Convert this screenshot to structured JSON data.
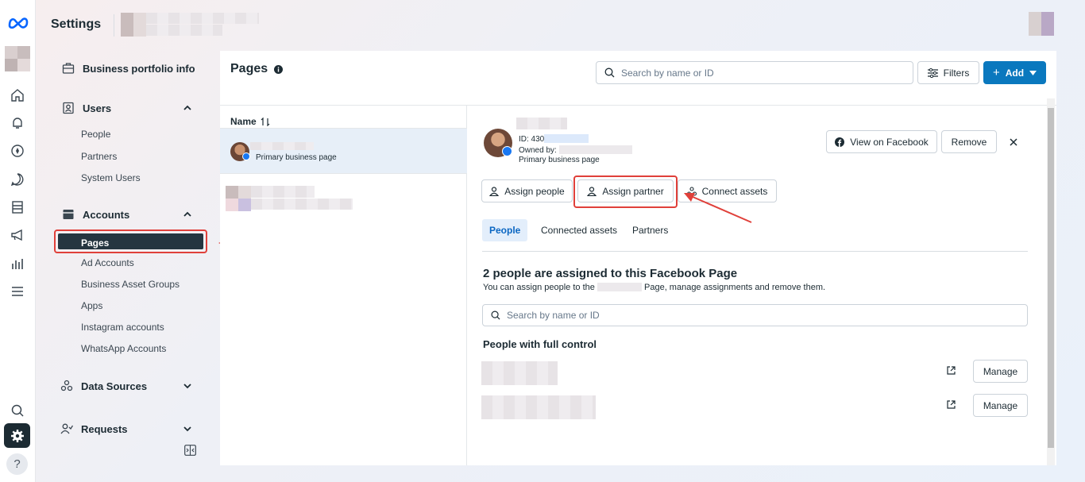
{
  "app": {
    "title": "Settings"
  },
  "rail": {
    "icons": [
      "meta-logo",
      "home-icon",
      "bell-icon",
      "compass-icon",
      "chat-icon",
      "pages-icon",
      "megaphone-icon",
      "chart-icon",
      "menu-icon",
      "search-icon",
      "gear-icon",
      "help-icon"
    ]
  },
  "sidebar": {
    "portfolio_info": "Business portfolio info",
    "users": {
      "label": "Users",
      "items": [
        "People",
        "Partners",
        "System Users"
      ]
    },
    "accounts": {
      "label": "Accounts",
      "items": [
        "Pages",
        "Ad Accounts",
        "Business Asset Groups",
        "Apps",
        "Instagram accounts",
        "WhatsApp Accounts"
      ]
    },
    "data_sources": "Data Sources",
    "requests": "Requests"
  },
  "header": {
    "title": "Pages",
    "search_placeholder": "Search by name or ID",
    "filters_label": "Filters",
    "add_label": "Add"
  },
  "list": {
    "column_name": "Name",
    "rows": [
      {
        "subtitle": "Primary business page"
      }
    ]
  },
  "detail": {
    "id_prefix": "ID: 430",
    "owned_by": "Owned by:",
    "page_type": "Primary business page",
    "view_on_facebook": "View on Facebook",
    "remove": "Remove",
    "assign_people": "Assign people",
    "assign_partner": "Assign partner",
    "connect_assets": "Connect assets",
    "tabs": [
      "People",
      "Connected assets",
      "Partners"
    ],
    "heading": "2 people are assigned to this Facebook Page",
    "sub_pre": "You can assign people to the",
    "sub_post": "Page, manage assignments and remove them.",
    "search_placeholder": "Search by name or ID",
    "full_control_label": "People with full control",
    "people": [
      {
        "action": "Manage"
      },
      {
        "action": "Manage"
      }
    ]
  },
  "colors": {
    "accent": "#0a78be",
    "highlight": "#e0403a",
    "active_nav": "#253540"
  }
}
